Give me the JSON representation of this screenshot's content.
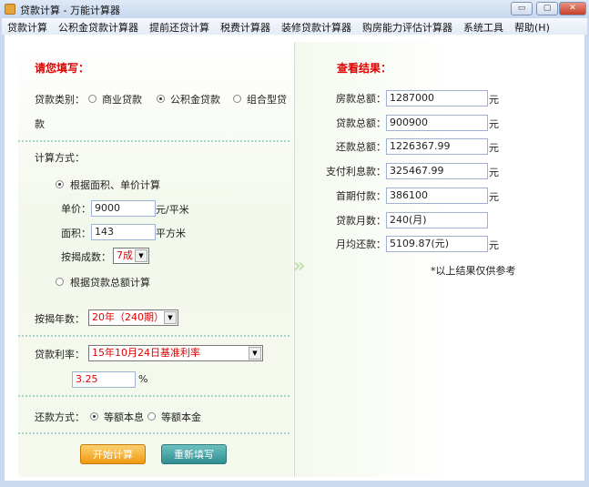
{
  "window": {
    "title": "贷款计算 - 万能计算器",
    "min": "▭",
    "max": "▢",
    "close": "✕"
  },
  "menu": [
    "贷款计算",
    "公积金贷款计算器",
    "提前还贷计算",
    "税费计算器",
    "装修贷款计算器",
    "购房能力评估计算器",
    "系统工具",
    "帮助(H)"
  ],
  "form": {
    "heading": "请您填写：",
    "loan_type_label": "贷款类别：",
    "loan_types": [
      "商业贷款",
      "公积金贷款",
      "组合型贷",
      "款"
    ],
    "loan_type_selected": "公积金贷款",
    "calc_method_label": "计算方式：",
    "method_area": "根据面积、单价计算",
    "unit_price_label": "单价：",
    "unit_price": "9000",
    "unit_price_unit": "元/平米",
    "area_label": "面积：",
    "area": "143",
    "area_unit": "平方米",
    "ratio_label": "按揭成数：",
    "ratio": "7成",
    "method_total": "根据贷款总额计算",
    "years_label": "按揭年数：",
    "years": "20年（240期）",
    "rate_label": "贷款利率：",
    "rate_option": "15年10月24日基准利率",
    "rate": "3.25",
    "rate_unit": "%",
    "repay_label": "还款方式：",
    "repay_options": [
      "等额本息",
      "等额本金"
    ],
    "repay_selected": "等额本息",
    "start": "开始计算",
    "reset": "重新填写"
  },
  "results": {
    "heading": "查看结果：",
    "rows": [
      {
        "label": "房款总额：",
        "value": "1287000",
        "unit": "元"
      },
      {
        "label": "贷款总额：",
        "value": "900900",
        "unit": "元"
      },
      {
        "label": "还款总额：",
        "value": "1226367.99",
        "unit": "元"
      },
      {
        "label": "支付利息款：",
        "value": "325467.99",
        "unit": "元"
      },
      {
        "label": "首期付款：",
        "value": "386100",
        "unit": "元"
      },
      {
        "label": "贷款月数：",
        "value": "240(月)",
        "unit": ""
      },
      {
        "label": "月均还款：",
        "value": "5109.87(元)",
        "unit": "元"
      }
    ],
    "note": "*以上结果仅供参考"
  },
  "colors": {
    "accent_red": "#e00000",
    "start_button": "#f0a020",
    "reset_button": "#3a9a9a"
  }
}
